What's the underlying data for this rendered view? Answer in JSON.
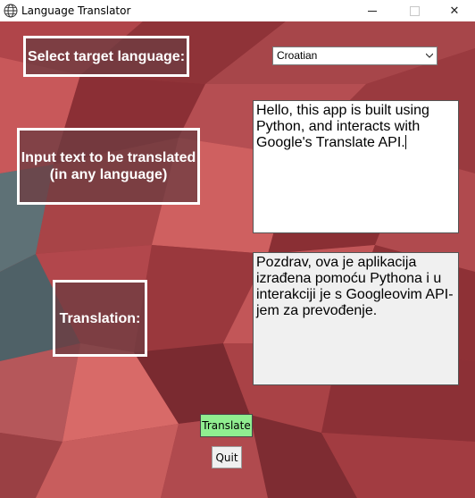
{
  "window": {
    "title": "Language Translator",
    "min_glyph": "",
    "max_glyph": "",
    "close_glyph": "✕"
  },
  "labels": {
    "target_language": "Select target language:",
    "input_text_line1": "Input text to be translated",
    "input_text_line2": "(in any language)",
    "translation": "Translation:"
  },
  "language_select": {
    "selected": "Croatian"
  },
  "input_text": {
    "value": "Hello, this app is built using Python, and interacts with Google's Translate API."
  },
  "output_text": {
    "value": "Pozdrav, ova je aplikacija izrađena pomoću Pythona i u interakciji je s Googleovim API-jem za prevođenje."
  },
  "buttons": {
    "translate": "Translate",
    "quit": "Quit"
  },
  "colors": {
    "translate_button_bg": "#90ee90",
    "label_border": "#ffffff",
    "background_primary": "#9c3a3f"
  }
}
